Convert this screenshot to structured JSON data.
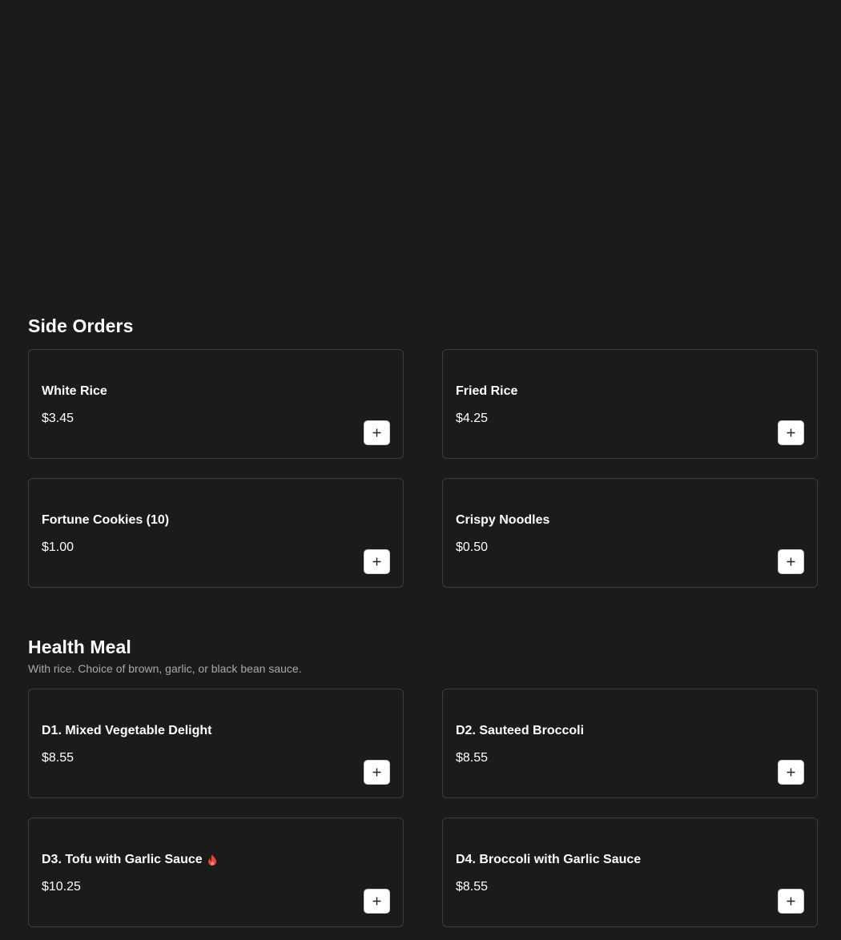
{
  "sections": [
    {
      "title": "Side Orders",
      "description": "",
      "items": [
        {
          "name": "White Rice",
          "price": "$3.45",
          "spicy": false
        },
        {
          "name": "Fried Rice",
          "price": "$4.25",
          "spicy": false
        },
        {
          "name": "Fortune Cookies (10)",
          "price": "$1.00",
          "spicy": false
        },
        {
          "name": "Crispy Noodles",
          "price": "$0.50",
          "spicy": false
        }
      ]
    },
    {
      "title": "Health Meal",
      "description": "With rice. Choice of brown, garlic, or black bean sauce.",
      "items": [
        {
          "name": "D1. Mixed Vegetable Delight",
          "price": "$8.55",
          "spicy": false
        },
        {
          "name": "D2. Sauteed Broccoli",
          "price": "$8.55",
          "spicy": false
        },
        {
          "name": "D3. Tofu with Garlic Sauce",
          "price": "$10.25",
          "spicy": true
        },
        {
          "name": "D4. Broccoli with Garlic Sauce",
          "price": "$8.55",
          "spicy": false
        }
      ]
    }
  ],
  "icons": {
    "add": "plus-icon",
    "spicy": "flame-icon"
  },
  "colors": {
    "background": "#1b1b1b",
    "card_border": "#3d3d3d",
    "spicy": "#e5473d",
    "button_bg": "#ffffff"
  }
}
